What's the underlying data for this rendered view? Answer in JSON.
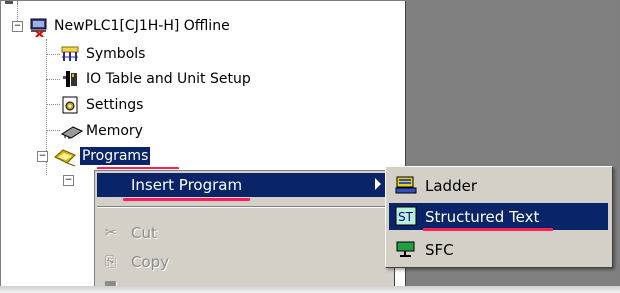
{
  "tree": {
    "root_label": "NewPLC1[CJ1H-H] Offline",
    "items": [
      {
        "label": "Symbols",
        "icon": "symbols-icon"
      },
      {
        "label": "IO Table and Unit Setup",
        "icon": "io-table-icon"
      },
      {
        "label": "Settings",
        "icon": "settings-icon"
      },
      {
        "label": "Memory",
        "icon": "memory-icon"
      },
      {
        "label": "Programs",
        "icon": "programs-icon"
      }
    ],
    "expander_minus": "−"
  },
  "context_menu": {
    "insert_program": "Insert Program",
    "cut": "Cut",
    "copy": "Copy"
  },
  "submenu": {
    "ladder": "Ladder",
    "structured_text": "Structured Text",
    "sfc": "SFC"
  },
  "colors": {
    "selection": "#0a246a",
    "menu_bg": "#d4d0c8",
    "annotation_red": "#ff1e5a",
    "workspace_gray": "#808080"
  }
}
